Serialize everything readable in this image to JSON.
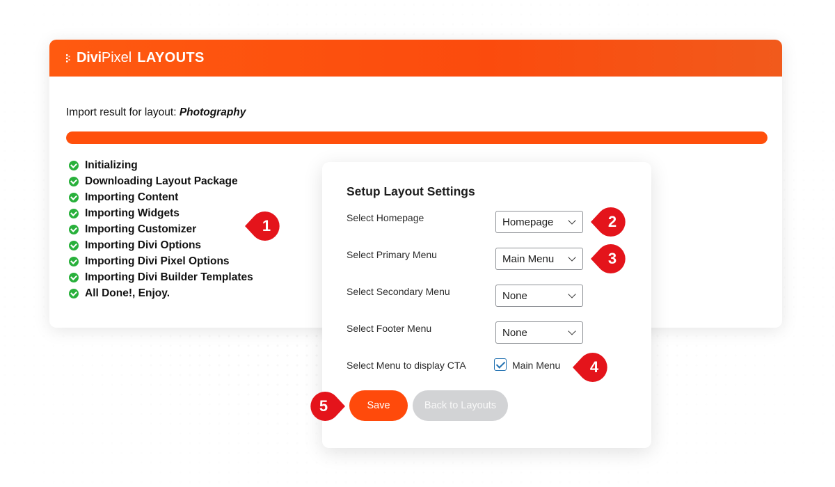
{
  "brand": {
    "divi": "Divi",
    "pixel": "Pixel",
    "layouts": "LAYOUTS",
    "accent_color": "#ff4f0b",
    "logo_icon": "divi-pixel-logo-icon"
  },
  "import": {
    "prefix": "Import result for layout: ",
    "layout_name": "Photography",
    "progress_percent": 100
  },
  "steps": [
    "Initializing",
    "Downloading Layout Package",
    "Importing Content",
    "Importing Widgets",
    "Importing Customizer",
    "Importing Divi Options",
    "Importing Divi Pixel Options",
    "Importing Divi Builder Templates",
    "All Done!, Enjoy."
  ],
  "settings": {
    "title": "Setup Layout Settings",
    "homepage": {
      "label": "Select Homepage",
      "value": "Homepage"
    },
    "primary_menu": {
      "label": "Select Primary Menu",
      "value": "Main Menu"
    },
    "secondary_menu": {
      "label": "Select Secondary Menu",
      "value": "None"
    },
    "footer_menu": {
      "label": "Select Footer Menu",
      "value": "None"
    },
    "cta_menu": {
      "label": "Select Menu to display CTA",
      "option": "Main Menu",
      "checked": true
    },
    "save_label": "Save",
    "back_label": "Back to Layouts"
  },
  "markers": {
    "m1": "1",
    "m2": "2",
    "m3": "3",
    "m4": "4",
    "m5": "5",
    "color": "#e4141b"
  }
}
